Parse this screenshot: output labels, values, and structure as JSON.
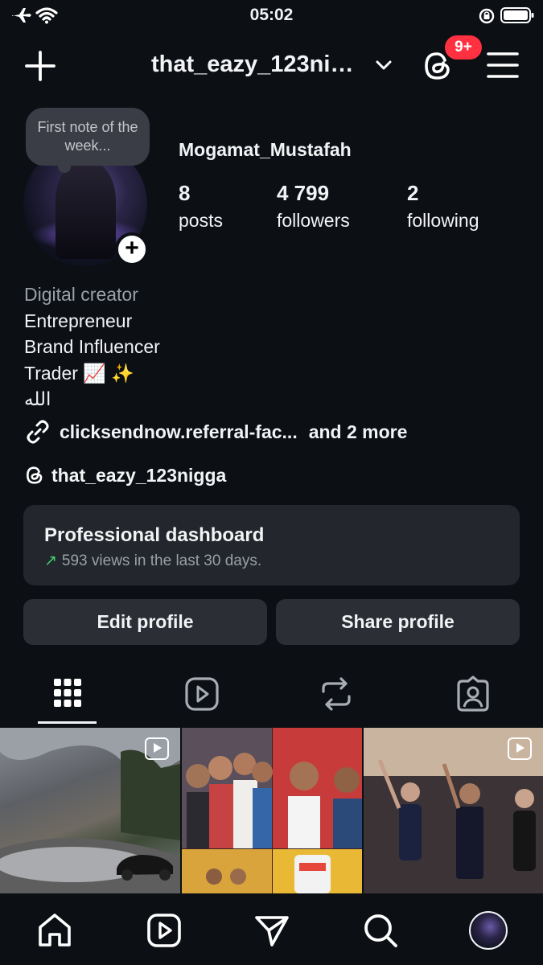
{
  "status_bar": {
    "time": "05:02"
  },
  "header": {
    "username": "that_eazy_123nigga",
    "notification_badge": "9+"
  },
  "profile": {
    "note": "First note of the week...",
    "display_name": "Mogamat_Mustafah",
    "stats": [
      {
        "value": "8",
        "label": "posts"
      },
      {
        "value": "4 799",
        "label": "followers"
      },
      {
        "value": "2",
        "label": "following"
      }
    ],
    "bio": {
      "category": "Digital creator",
      "lines": [
        "Entrepreneur",
        "Brand Influencer",
        "Trader 📈 ✨",
        "الله"
      ]
    },
    "link": "clicksendnow.referral-fac...",
    "link_more": "and 2 more",
    "threads_handle": "that_eazy_123nigga"
  },
  "dashboard": {
    "title": "Professional dashboard",
    "subtitle": "593 views in the last 30 days."
  },
  "buttons": {
    "edit": "Edit profile",
    "share": "Share profile"
  },
  "tabs": [
    "grid-icon",
    "reels-icon",
    "reposts-icon",
    "tagged-icon"
  ],
  "colors": {
    "background": "#0c0f14",
    "badge": "#ff3040",
    "trend": "#3ccf6e"
  }
}
